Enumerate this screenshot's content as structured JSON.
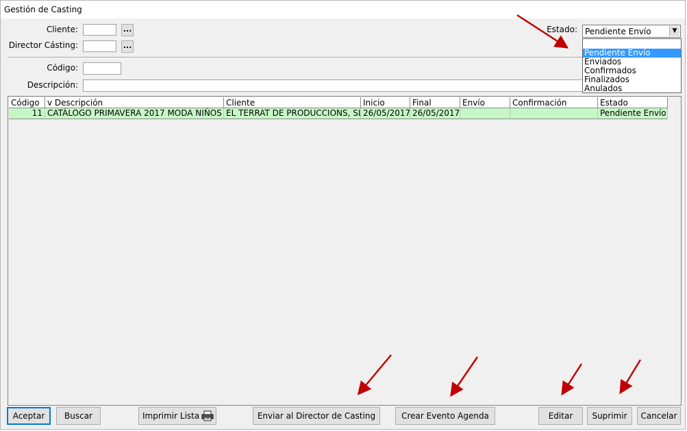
{
  "window": {
    "title": "Gestión de Casting"
  },
  "filters": {
    "cliente_label": "Cliente:",
    "director_label": "Director Cásting:",
    "codigo_label": "Código:",
    "descripcion_label": "Descripción:",
    "ellipsis": "...",
    "estado_label": "Estado:",
    "estado_value": "Pendiente Envío",
    "estado_options": [
      "",
      "Pendiente Envío",
      "Enviados",
      "Confirmados",
      "Finalizados",
      "Anulados"
    ]
  },
  "grid": {
    "columns": [
      "Código",
      "v Descripción",
      "Cliente",
      "Inicio",
      "Final",
      "Envío",
      "Confirmación",
      "Estado"
    ],
    "rows": [
      [
        "11",
        "CATÁLOGO PRIMAVERA 2017 MODA NIÑOS",
        "EL TERRAT DE PRODUCCIONS, SL",
        "26/05/2017",
        "26/05/2017",
        "",
        "",
        "Pendiente Envío"
      ]
    ],
    "row_color": "#c7f7c7"
  },
  "buttons": {
    "aceptar": "Aceptar",
    "buscar": "Buscar",
    "imprimir": "Imprimir Lista",
    "enviar": "Enviar al Director de Casting",
    "crear": "Crear Evento Agenda",
    "editar": "Editar",
    "suprimir": "Suprimir",
    "cancelar": "Cancelar"
  },
  "annotation_color": "#c00000"
}
